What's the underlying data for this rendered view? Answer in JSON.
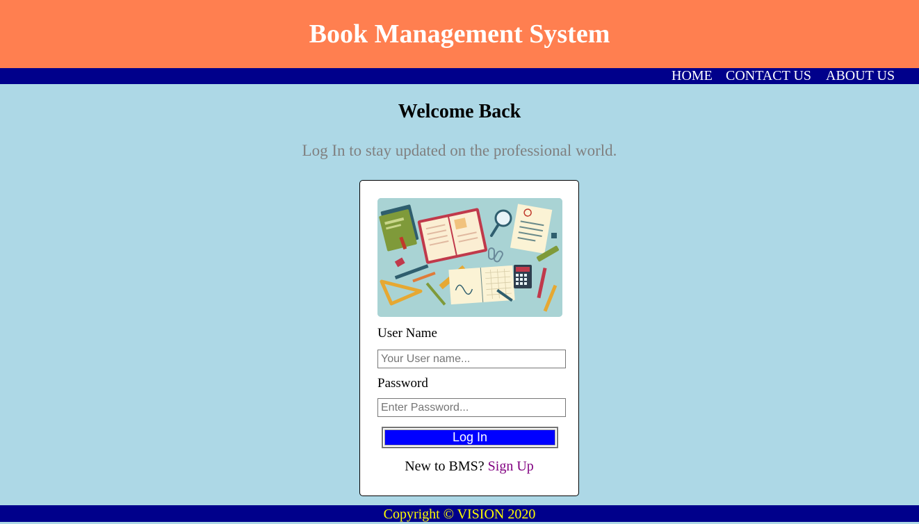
{
  "header": {
    "title": "Book Management System"
  },
  "nav": {
    "home": "HOME",
    "contact": "CONTACT US",
    "about": "ABOUT US"
  },
  "main": {
    "heading": "Welcome Back",
    "subtitle": "Log In to stay updated on the professional world."
  },
  "login": {
    "image": "study-desk-illustration",
    "username_label": "User Name",
    "username_placeholder": "Your User name...",
    "username_value": "",
    "password_label": "Password",
    "password_placeholder": "Enter Password...",
    "password_value": "",
    "submit_label": "Log In",
    "signup_prompt": "New to BMS?",
    "signup_link": "Sign Up"
  },
  "footer": {
    "text": "Copyright © VISION 2020"
  },
  "colors": {
    "header_bg": "#ff7f50",
    "nav_bg": "#00008b",
    "page_bg": "#add8e6",
    "button_bg": "#0000ff",
    "footer_text": "#ffff00",
    "link": "#800080"
  }
}
